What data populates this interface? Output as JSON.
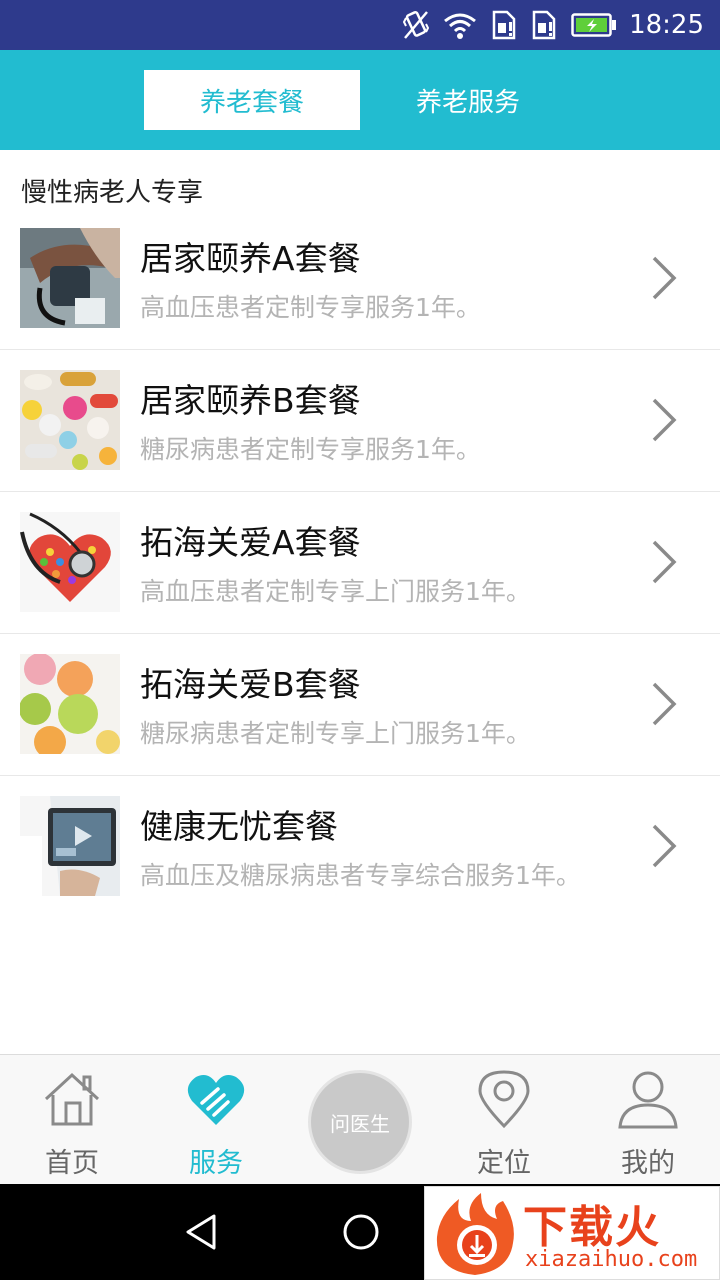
{
  "status_bar": {
    "time": "18:25",
    "icons": [
      "vibrate-icon",
      "wifi-icon",
      "sim1-alert-icon",
      "sim2-alert-icon",
      "battery-charging-icon"
    ]
  },
  "header": {
    "tabs": [
      {
        "label": "养老套餐",
        "active": true
      },
      {
        "label": "养老服务",
        "active": false
      }
    ],
    "accent_color": "#22bcd0"
  },
  "section": {
    "title": "慢性病老人专享"
  },
  "packages": [
    {
      "title": "居家颐养A套餐",
      "desc": "高血压患者定制专享服务1年。",
      "thumb": "blood-pressure-photo"
    },
    {
      "title": "居家颐养B套餐",
      "desc": "糖尿病患者定制专享服务1年。",
      "thumb": "pills-photo"
    },
    {
      "title": "拓海关爱A套餐",
      "desc": "高血压患者定制专享上门服务1年。",
      "thumb": "stethoscope-heart-photo"
    },
    {
      "title": "拓海关爱B套餐",
      "desc": "糖尿病患者定制专享上门服务1年。",
      "thumb": "candies-photo"
    },
    {
      "title": "健康无忧套餐",
      "desc": "高血压及糖尿病患者专享综合服务1年。",
      "thumb": "doctor-tablet-photo"
    }
  ],
  "bottom_nav": {
    "items": [
      {
        "label": "首页",
        "icon": "home-icon",
        "active": false
      },
      {
        "label": "服务",
        "icon": "heart-hands-icon",
        "active": true
      },
      {
        "label": "定位",
        "icon": "location-pin-icon",
        "active": false
      },
      {
        "label": "我的",
        "icon": "user-icon",
        "active": false
      }
    ],
    "center_button": "问医生"
  },
  "watermark": {
    "text": "下载火",
    "url": "xiazaihuo.com"
  }
}
